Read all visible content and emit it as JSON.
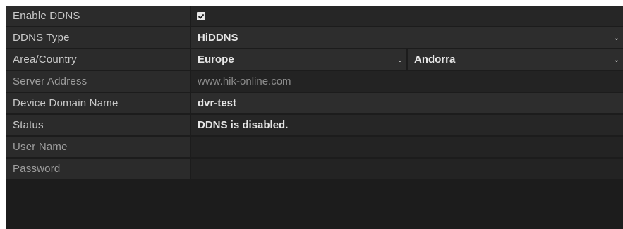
{
  "ddns": {
    "enable": {
      "label": "Enable DDNS",
      "checked": true,
      "icon": "checkbox-checked-icon"
    },
    "type": {
      "label": "DDNS Type",
      "value": "HiDDNS"
    },
    "area": {
      "label": "Area/Country",
      "region": "Europe",
      "country": "Andorra"
    },
    "server_address": {
      "label": "Server Address",
      "value": "www.hik-online.com"
    },
    "device_domain": {
      "label": "Device Domain Name",
      "value": "dvr-test"
    },
    "status": {
      "label": "Status",
      "value": "DDNS is disabled."
    },
    "user_name": {
      "label": "User Name",
      "value": ""
    },
    "password": {
      "label": "Password",
      "value": ""
    }
  },
  "icons": {
    "dropdown": "chevron-down-icon"
  },
  "colors": {
    "panel_background": "#1c1c1c",
    "label_background": "#2b2b2b",
    "field_background": "#2d2d2d",
    "text": "#e6e6e6"
  }
}
